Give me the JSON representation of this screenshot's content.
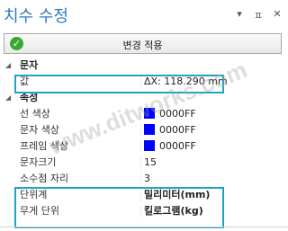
{
  "window": {
    "title": "치수 수정",
    "controls": {
      "dropdown": "▾",
      "pin": "ㅍ",
      "close": "✕"
    }
  },
  "toolbar": {
    "apply_label": "변경 적용",
    "apply_icon": "check-circle-icon"
  },
  "sections": [
    {
      "label": "문자",
      "arrow": "◢"
    },
    {
      "label": "속성",
      "arrow": "◢"
    }
  ],
  "text_props": [
    {
      "name": "값",
      "value": "ΔX: 118.290 mm"
    }
  ],
  "attr_props": [
    {
      "name": "선 색상",
      "value": "0000FF",
      "color": "#0000FF"
    },
    {
      "name": "문자 색상",
      "value": "0000FF",
      "color": "#0000FF"
    },
    {
      "name": "프레임 색상",
      "value": "0000FF",
      "color": "#0000FF"
    },
    {
      "name": "문자크기",
      "value": "15"
    },
    {
      "name": "소수점 자리",
      "value": "3"
    },
    {
      "name": "단위계",
      "value": "밀리미터(mm)"
    },
    {
      "name": "무게 단위",
      "value": "킬로그램(kg)"
    }
  ],
  "watermark": "www.ditworks.com",
  "colors": {
    "highlight": "#1fa2c9",
    "title": "#2b79c2",
    "swatch": "#0000FF"
  }
}
